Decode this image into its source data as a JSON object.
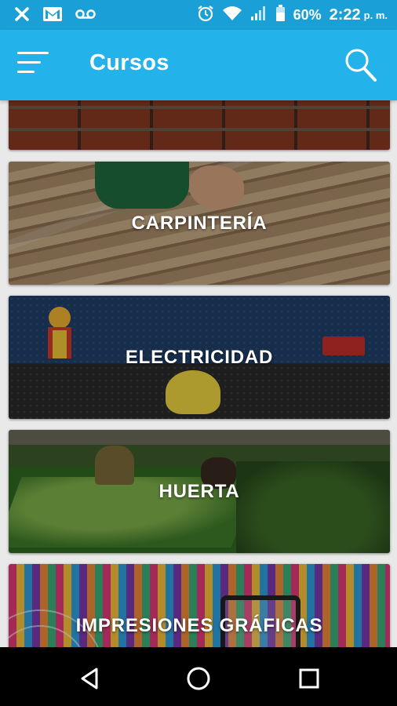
{
  "status_bar": {
    "battery_percent": "60%",
    "time": "2:22",
    "ampm": "p. m."
  },
  "app_bar": {
    "title": "Cursos"
  },
  "courses": [
    {
      "label": ""
    },
    {
      "label": "CARPINTERÍA"
    },
    {
      "label": "ELECTRICIDAD"
    },
    {
      "label": "HUERTA"
    },
    {
      "label": "IMPRESIONES GRÁFICAS"
    }
  ],
  "icons": {
    "status_left": [
      "close-icon",
      "gmail-icon",
      "voicemail-icon"
    ],
    "status_right": [
      "alarm-icon",
      "wifi-icon",
      "signal-icon",
      "battery-icon"
    ],
    "app_bar": [
      "menu-icon",
      "search-icon"
    ],
    "navigation": [
      "back-icon",
      "home-icon",
      "recents-icon"
    ]
  },
  "colors": {
    "status_bar": "#1a9fd6",
    "app_bar": "#23b3ea",
    "background": "#e9e9e9",
    "nav_bar": "#000000"
  }
}
